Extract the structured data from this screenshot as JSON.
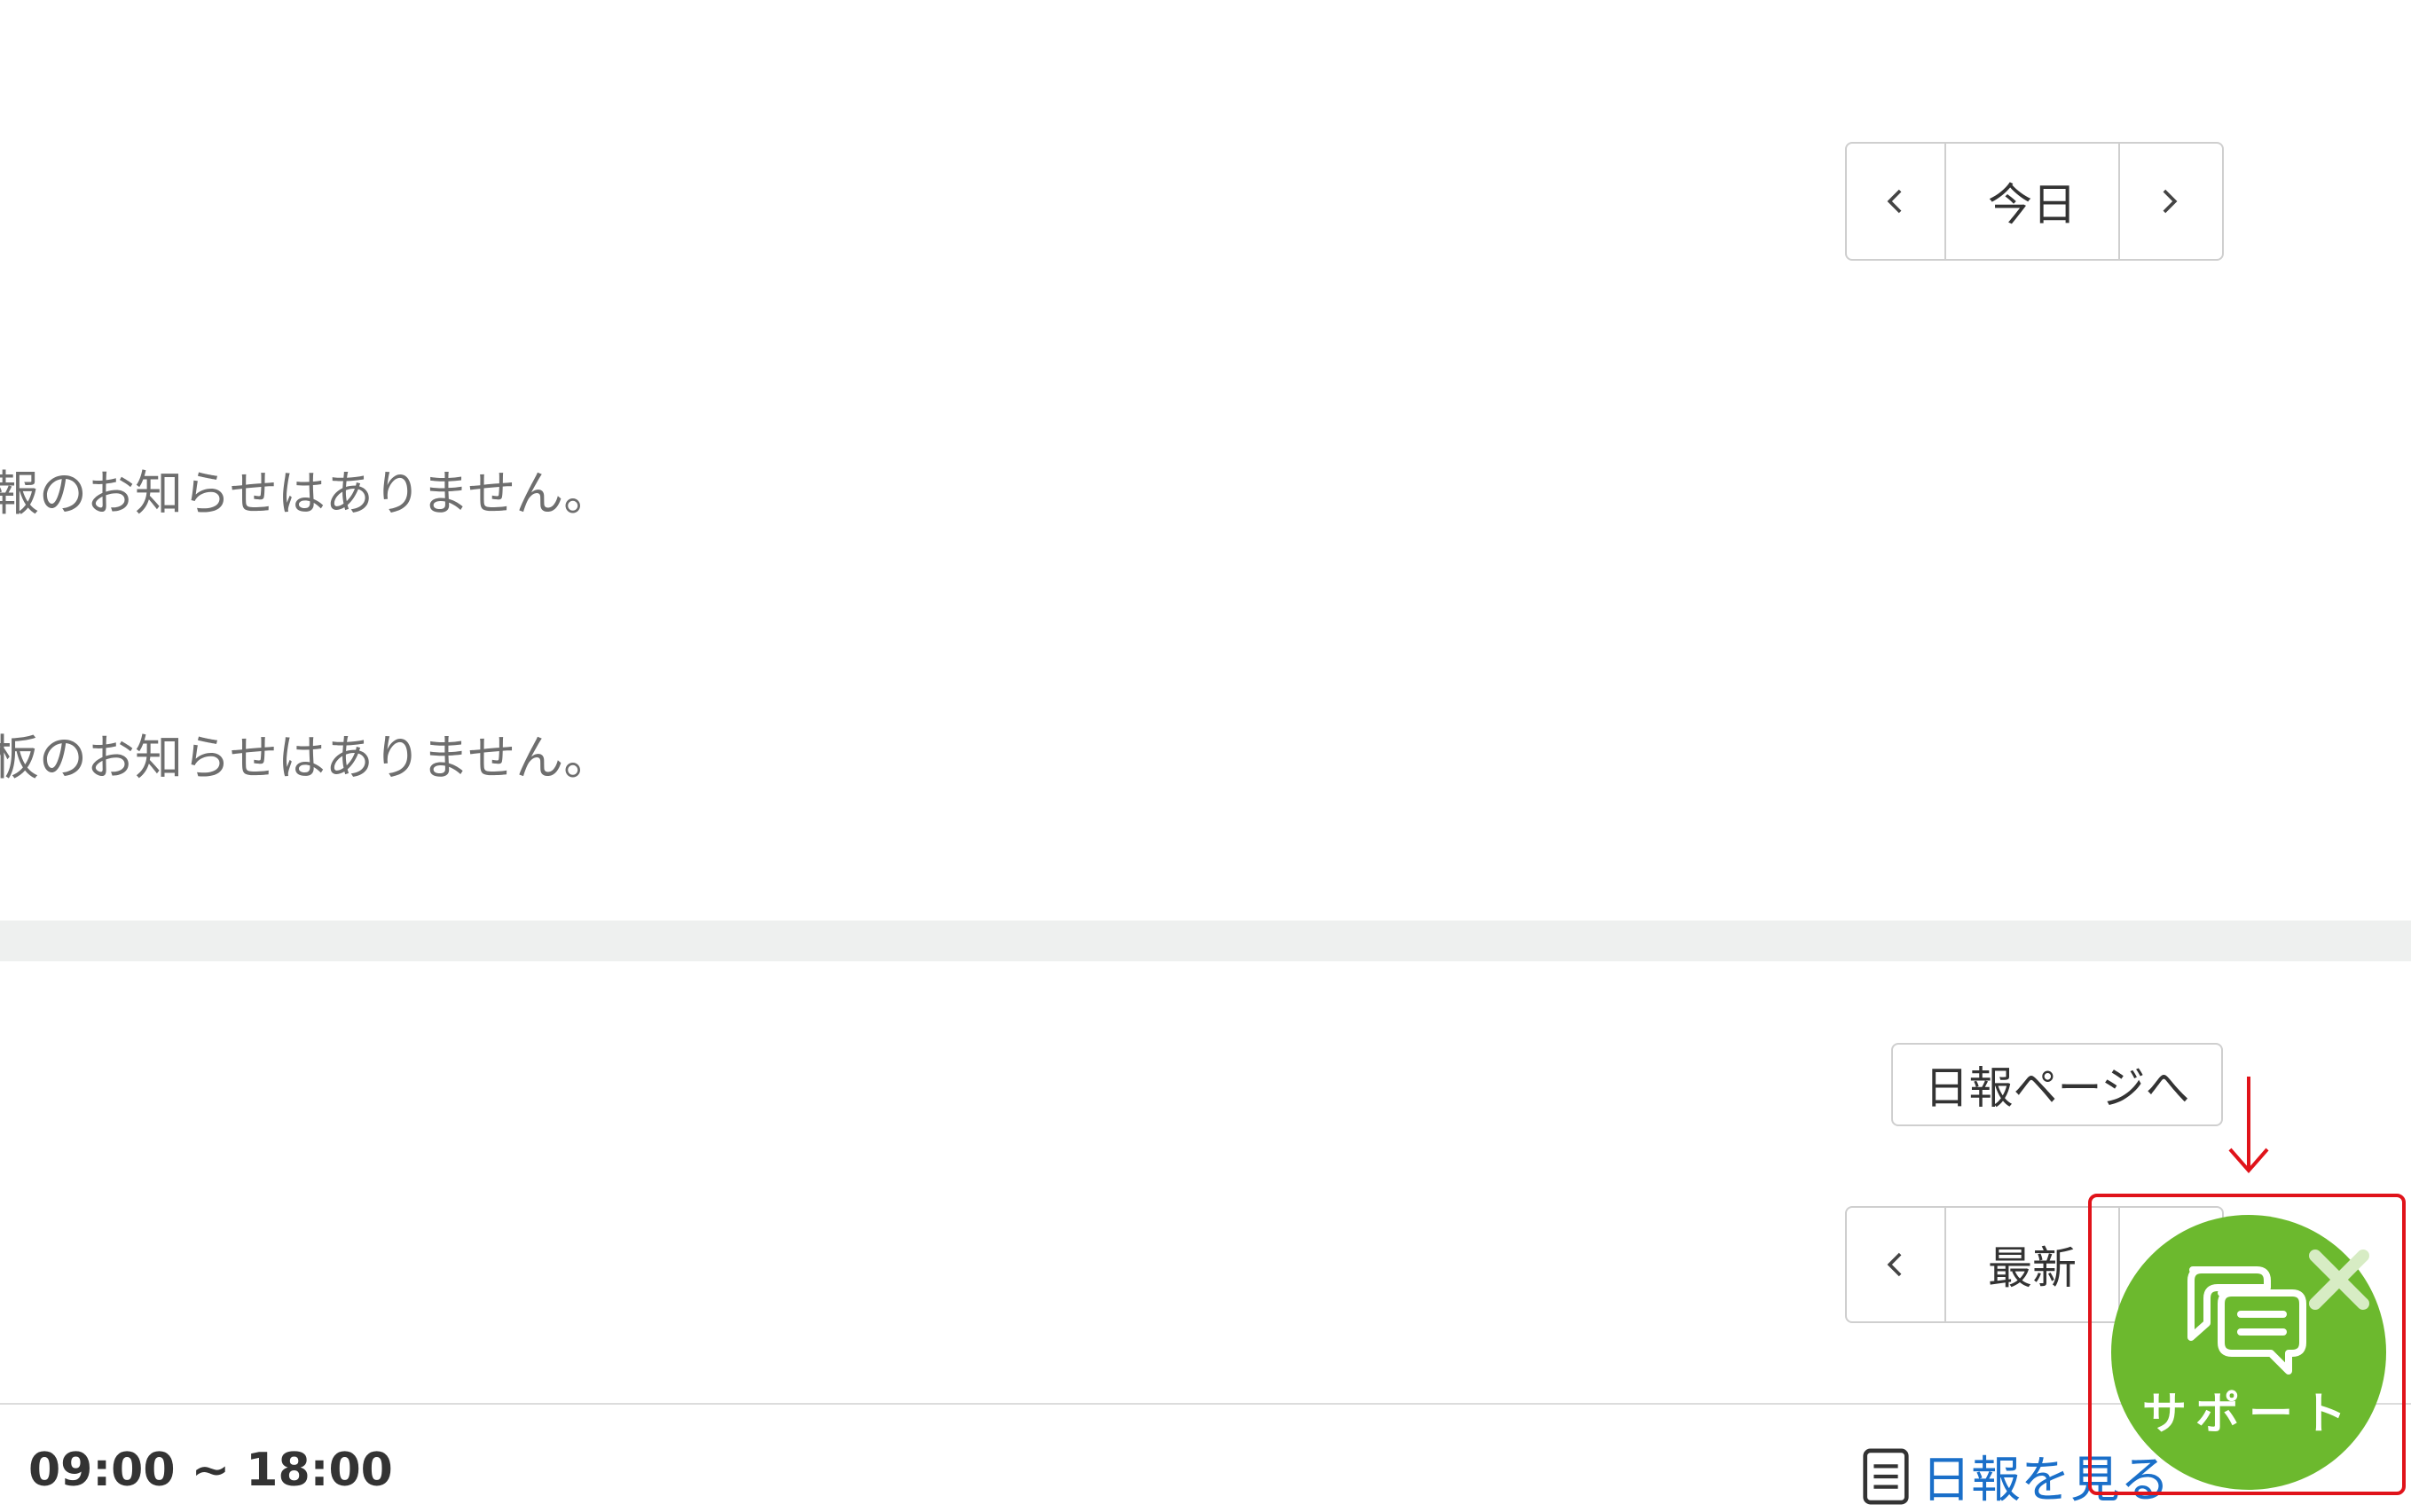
{
  "calendar_pager": {
    "prev_icon": "chevron-left-icon",
    "label": "今日",
    "next_icon": "chevron-right-icon"
  },
  "notices": [
    "報のお知らせはありません。",
    "板のお知らせはありません。"
  ],
  "daily_report": {
    "page_button_label": "日報ページへ",
    "pager_prev_icon": "chevron-left-icon",
    "pager_label": "最新",
    "time_range": "09:00 ~ 18:00",
    "view_link_icon": "document-icon",
    "view_link_label": "日報を見る"
  },
  "support_widget": {
    "label": "サポート",
    "icon": "chat-bubbles-icon",
    "close_icon": "close-icon",
    "color": "#6cb92e"
  },
  "annotation": {
    "color": "#e0131a",
    "arrow_icon": "down-arrow-icon"
  }
}
